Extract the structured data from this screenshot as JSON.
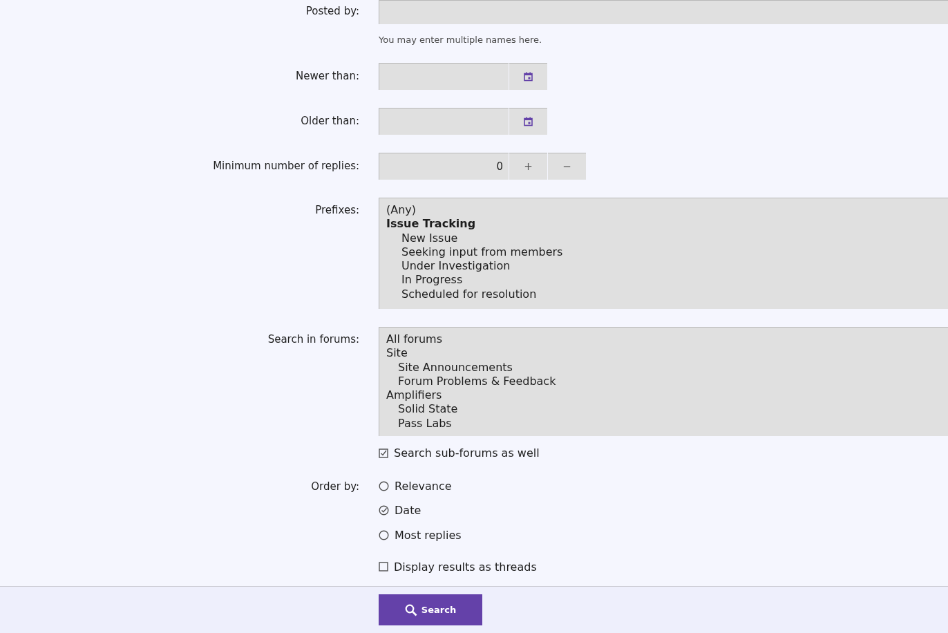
{
  "posted_by": {
    "label": "Posted by:",
    "hint": "You may enter multiple names here."
  },
  "newer_than": {
    "label": "Newer than:"
  },
  "older_than": {
    "label": "Older than:"
  },
  "min_replies": {
    "label": "Minimum number of replies:",
    "value": "0",
    "plus": "+",
    "minus": "−"
  },
  "prefixes": {
    "label": "Prefixes:",
    "options": [
      {
        "text": "(Any)",
        "kind": "option"
      },
      {
        "text": "Issue Tracking",
        "kind": "group"
      },
      {
        "text": "New Issue",
        "kind": "child"
      },
      {
        "text": "Seeking input from members",
        "kind": "child"
      },
      {
        "text": "Under Investigation",
        "kind": "child"
      },
      {
        "text": "In Progress",
        "kind": "child"
      },
      {
        "text": "Scheduled for resolution",
        "kind": "child"
      }
    ]
  },
  "forums": {
    "label": "Search in forums:",
    "options": [
      {
        "text": "All forums",
        "kind": "option"
      },
      {
        "text": "Site",
        "kind": "option"
      },
      {
        "text": "Site Announcements",
        "kind": "child"
      },
      {
        "text": "Forum Problems & Feedback",
        "kind": "child"
      },
      {
        "text": "Amplifiers",
        "kind": "option"
      },
      {
        "text": "Solid State",
        "kind": "child"
      },
      {
        "text": "Pass Labs",
        "kind": "child"
      }
    ]
  },
  "sub_forums": {
    "label": "Search sub-forums as well",
    "checked": true
  },
  "order_by": {
    "label": "Order by:",
    "options": [
      {
        "label": "Relevance",
        "selected": false
      },
      {
        "label": "Date",
        "selected": true
      },
      {
        "label": "Most replies",
        "selected": false
      }
    ]
  },
  "as_threads": {
    "label": "Display results as threads",
    "checked": false
  },
  "search_button": "Search"
}
